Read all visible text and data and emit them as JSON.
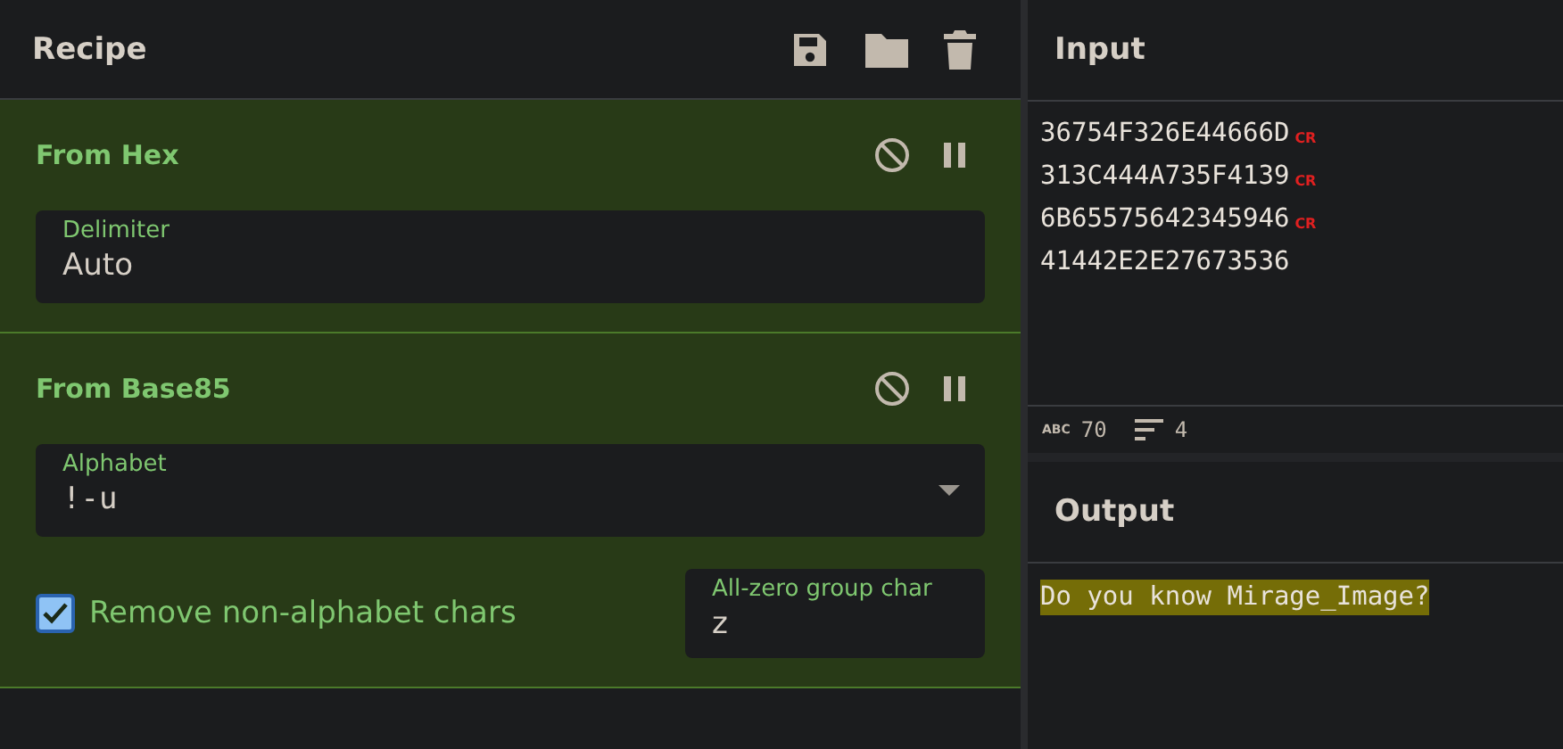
{
  "recipe": {
    "title": "Recipe",
    "operations": [
      {
        "name": "From Hex",
        "disabled": false,
        "breakpoint": false,
        "args": [
          {
            "kind": "text",
            "label": "Delimiter",
            "value": "Auto"
          }
        ]
      },
      {
        "name": "From Base85",
        "disabled": false,
        "breakpoint": false,
        "args": [
          {
            "kind": "select",
            "label": "Alphabet",
            "value": "!-u"
          },
          {
            "kind": "checkbox",
            "label": "Remove non-alphabet chars",
            "checked": true
          },
          {
            "kind": "short",
            "label": "All-zero group char",
            "value": "z"
          }
        ]
      }
    ]
  },
  "input": {
    "title": "Input",
    "lines": [
      {
        "text": "36754F326E44666D",
        "eol": "CR"
      },
      {
        "text": "313C444A735F4139",
        "eol": "CR"
      },
      {
        "text": "6B65575642345946",
        "eol": "CR"
      },
      {
        "text": "41442E2E27673536"
      }
    ],
    "stats": {
      "chars_icon": "ABC",
      "chars": "70",
      "lines": "4"
    }
  },
  "output": {
    "title": "Output",
    "text": "Do you know Mirage_Image?",
    "highlighted": true
  }
}
